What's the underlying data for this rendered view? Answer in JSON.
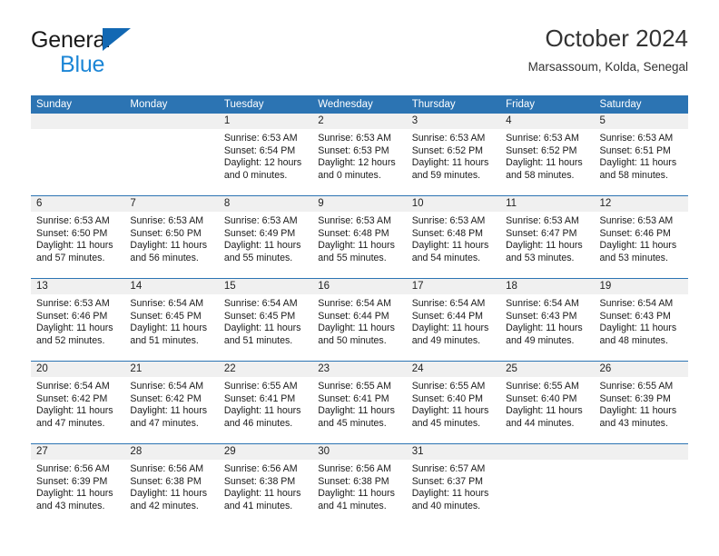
{
  "brand": {
    "line1": "General",
    "line2": "Blue",
    "triangle_color": "#1268b3",
    "blue_text_color": "#1c86d6"
  },
  "header": {
    "title": "October 2024",
    "subtitle": "Marsassoum, Kolda, Senegal"
  },
  "theme": {
    "header_blue": "#2c74b3",
    "day_band_gray": "#f0f0f0",
    "text": "#1a1a1a"
  },
  "weekdays": [
    "Sunday",
    "Monday",
    "Tuesday",
    "Wednesday",
    "Thursday",
    "Friday",
    "Saturday"
  ],
  "weeks": [
    [
      {
        "day": "",
        "sunrise": "",
        "sunset": "",
        "daylight": "",
        "empty": true
      },
      {
        "day": "",
        "sunrise": "",
        "sunset": "",
        "daylight": "",
        "empty": true
      },
      {
        "day": "1",
        "sunrise": "Sunrise: 6:53 AM",
        "sunset": "Sunset: 6:54 PM",
        "daylight": "Daylight: 12 hours and 0 minutes."
      },
      {
        "day": "2",
        "sunrise": "Sunrise: 6:53 AM",
        "sunset": "Sunset: 6:53 PM",
        "daylight": "Daylight: 12 hours and 0 minutes."
      },
      {
        "day": "3",
        "sunrise": "Sunrise: 6:53 AM",
        "sunset": "Sunset: 6:52 PM",
        "daylight": "Daylight: 11 hours and 59 minutes."
      },
      {
        "day": "4",
        "sunrise": "Sunrise: 6:53 AM",
        "sunset": "Sunset: 6:52 PM",
        "daylight": "Daylight: 11 hours and 58 minutes."
      },
      {
        "day": "5",
        "sunrise": "Sunrise: 6:53 AM",
        "sunset": "Sunset: 6:51 PM",
        "daylight": "Daylight: 11 hours and 58 minutes."
      }
    ],
    [
      {
        "day": "6",
        "sunrise": "Sunrise: 6:53 AM",
        "sunset": "Sunset: 6:50 PM",
        "daylight": "Daylight: 11 hours and 57 minutes."
      },
      {
        "day": "7",
        "sunrise": "Sunrise: 6:53 AM",
        "sunset": "Sunset: 6:50 PM",
        "daylight": "Daylight: 11 hours and 56 minutes."
      },
      {
        "day": "8",
        "sunrise": "Sunrise: 6:53 AM",
        "sunset": "Sunset: 6:49 PM",
        "daylight": "Daylight: 11 hours and 55 minutes."
      },
      {
        "day": "9",
        "sunrise": "Sunrise: 6:53 AM",
        "sunset": "Sunset: 6:48 PM",
        "daylight": "Daylight: 11 hours and 55 minutes."
      },
      {
        "day": "10",
        "sunrise": "Sunrise: 6:53 AM",
        "sunset": "Sunset: 6:48 PM",
        "daylight": "Daylight: 11 hours and 54 minutes."
      },
      {
        "day": "11",
        "sunrise": "Sunrise: 6:53 AM",
        "sunset": "Sunset: 6:47 PM",
        "daylight": "Daylight: 11 hours and 53 minutes."
      },
      {
        "day": "12",
        "sunrise": "Sunrise: 6:53 AM",
        "sunset": "Sunset: 6:46 PM",
        "daylight": "Daylight: 11 hours and 53 minutes."
      }
    ],
    [
      {
        "day": "13",
        "sunrise": "Sunrise: 6:53 AM",
        "sunset": "Sunset: 6:46 PM",
        "daylight": "Daylight: 11 hours and 52 minutes."
      },
      {
        "day": "14",
        "sunrise": "Sunrise: 6:54 AM",
        "sunset": "Sunset: 6:45 PM",
        "daylight": "Daylight: 11 hours and 51 minutes."
      },
      {
        "day": "15",
        "sunrise": "Sunrise: 6:54 AM",
        "sunset": "Sunset: 6:45 PM",
        "daylight": "Daylight: 11 hours and 51 minutes."
      },
      {
        "day": "16",
        "sunrise": "Sunrise: 6:54 AM",
        "sunset": "Sunset: 6:44 PM",
        "daylight": "Daylight: 11 hours and 50 minutes."
      },
      {
        "day": "17",
        "sunrise": "Sunrise: 6:54 AM",
        "sunset": "Sunset: 6:44 PM",
        "daylight": "Daylight: 11 hours and 49 minutes."
      },
      {
        "day": "18",
        "sunrise": "Sunrise: 6:54 AM",
        "sunset": "Sunset: 6:43 PM",
        "daylight": "Daylight: 11 hours and 49 minutes."
      },
      {
        "day": "19",
        "sunrise": "Sunrise: 6:54 AM",
        "sunset": "Sunset: 6:43 PM",
        "daylight": "Daylight: 11 hours and 48 minutes."
      }
    ],
    [
      {
        "day": "20",
        "sunrise": "Sunrise: 6:54 AM",
        "sunset": "Sunset: 6:42 PM",
        "daylight": "Daylight: 11 hours and 47 minutes."
      },
      {
        "day": "21",
        "sunrise": "Sunrise: 6:54 AM",
        "sunset": "Sunset: 6:42 PM",
        "daylight": "Daylight: 11 hours and 47 minutes."
      },
      {
        "day": "22",
        "sunrise": "Sunrise: 6:55 AM",
        "sunset": "Sunset: 6:41 PM",
        "daylight": "Daylight: 11 hours and 46 minutes."
      },
      {
        "day": "23",
        "sunrise": "Sunrise: 6:55 AM",
        "sunset": "Sunset: 6:41 PM",
        "daylight": "Daylight: 11 hours and 45 minutes."
      },
      {
        "day": "24",
        "sunrise": "Sunrise: 6:55 AM",
        "sunset": "Sunset: 6:40 PM",
        "daylight": "Daylight: 11 hours and 45 minutes."
      },
      {
        "day": "25",
        "sunrise": "Sunrise: 6:55 AM",
        "sunset": "Sunset: 6:40 PM",
        "daylight": "Daylight: 11 hours and 44 minutes."
      },
      {
        "day": "26",
        "sunrise": "Sunrise: 6:55 AM",
        "sunset": "Sunset: 6:39 PM",
        "daylight": "Daylight: 11 hours and 43 minutes."
      }
    ],
    [
      {
        "day": "27",
        "sunrise": "Sunrise: 6:56 AM",
        "sunset": "Sunset: 6:39 PM",
        "daylight": "Daylight: 11 hours and 43 minutes."
      },
      {
        "day": "28",
        "sunrise": "Sunrise: 6:56 AM",
        "sunset": "Sunset: 6:38 PM",
        "daylight": "Daylight: 11 hours and 42 minutes."
      },
      {
        "day": "29",
        "sunrise": "Sunrise: 6:56 AM",
        "sunset": "Sunset: 6:38 PM",
        "daylight": "Daylight: 11 hours and 41 minutes."
      },
      {
        "day": "30",
        "sunrise": "Sunrise: 6:56 AM",
        "sunset": "Sunset: 6:38 PM",
        "daylight": "Daylight: 11 hours and 41 minutes."
      },
      {
        "day": "31",
        "sunrise": "Sunrise: 6:57 AM",
        "sunset": "Sunset: 6:37 PM",
        "daylight": "Daylight: 11 hours and 40 minutes."
      },
      {
        "day": "",
        "sunrise": "",
        "sunset": "",
        "daylight": "",
        "empty": true
      },
      {
        "day": "",
        "sunrise": "",
        "sunset": "",
        "daylight": "",
        "empty": true
      }
    ]
  ]
}
